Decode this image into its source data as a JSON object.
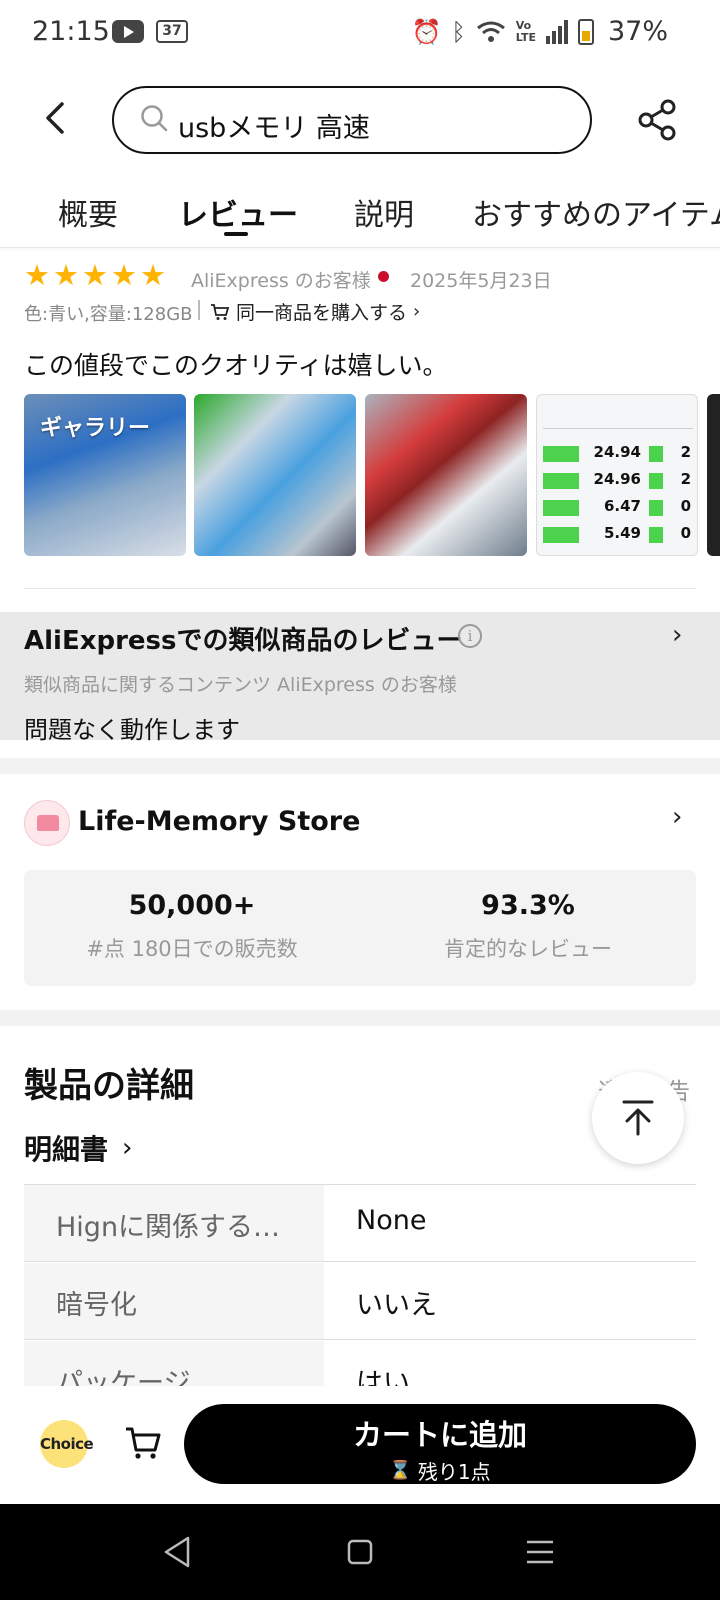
{
  "status_bar": {
    "time": "21:15",
    "notification_badge": "37",
    "battery_pct": "37%"
  },
  "search": {
    "query": "usbメモリ 高速"
  },
  "tabs": [
    {
      "label": "概要"
    },
    {
      "label": "レビュー"
    },
    {
      "label": "説明"
    },
    {
      "label": "おすすめのアイテム"
    }
  ],
  "review": {
    "rating": 5,
    "reviewer": "AliExpress のお客様",
    "date": "2025年5月23日",
    "variant": "色:青い,容量:128GB",
    "buy_same": "同一商品を購入する",
    "text": "この値段でこのクオリティは嬉しい。",
    "gallery_label": "ギャラリー",
    "benchmark_values": [
      {
        "read": "24.94",
        "write": "2"
      },
      {
        "read": "24.96",
        "write": "2"
      },
      {
        "read": "6.47",
        "write": "0"
      },
      {
        "read": "5.49",
        "write": "0"
      }
    ]
  },
  "similar_reviews": {
    "title": "AliExpressでの類似商品のレビュー",
    "subtitle": "類似商品に関するコンテンツ AliExpress のお客様",
    "text": "問題なく動作します"
  },
  "store": {
    "name": "Life-Memory Store",
    "stats": [
      {
        "value": "50,000+",
        "label": "#点 180日での販売数"
      },
      {
        "value": "93.3%",
        "label": "肯定的なレビュー"
      }
    ]
  },
  "details": {
    "title": "製品の詳細",
    "report_label": "違反報告",
    "spec_link": "明細書",
    "specs": [
      {
        "key": "Hignに関係する…",
        "value": "None"
      },
      {
        "key": "暗号化",
        "value": "いいえ"
      },
      {
        "key": "パッケージ",
        "value": "はい"
      }
    ]
  },
  "bottom_bar": {
    "choice_label": "Choice",
    "add_to_cart": "カートに追加",
    "stock": "残り1点"
  },
  "colors": {
    "star": "#fdb300",
    "flag": "#c8102e",
    "choice_badge": "#fde27a",
    "cta": "#000000"
  }
}
